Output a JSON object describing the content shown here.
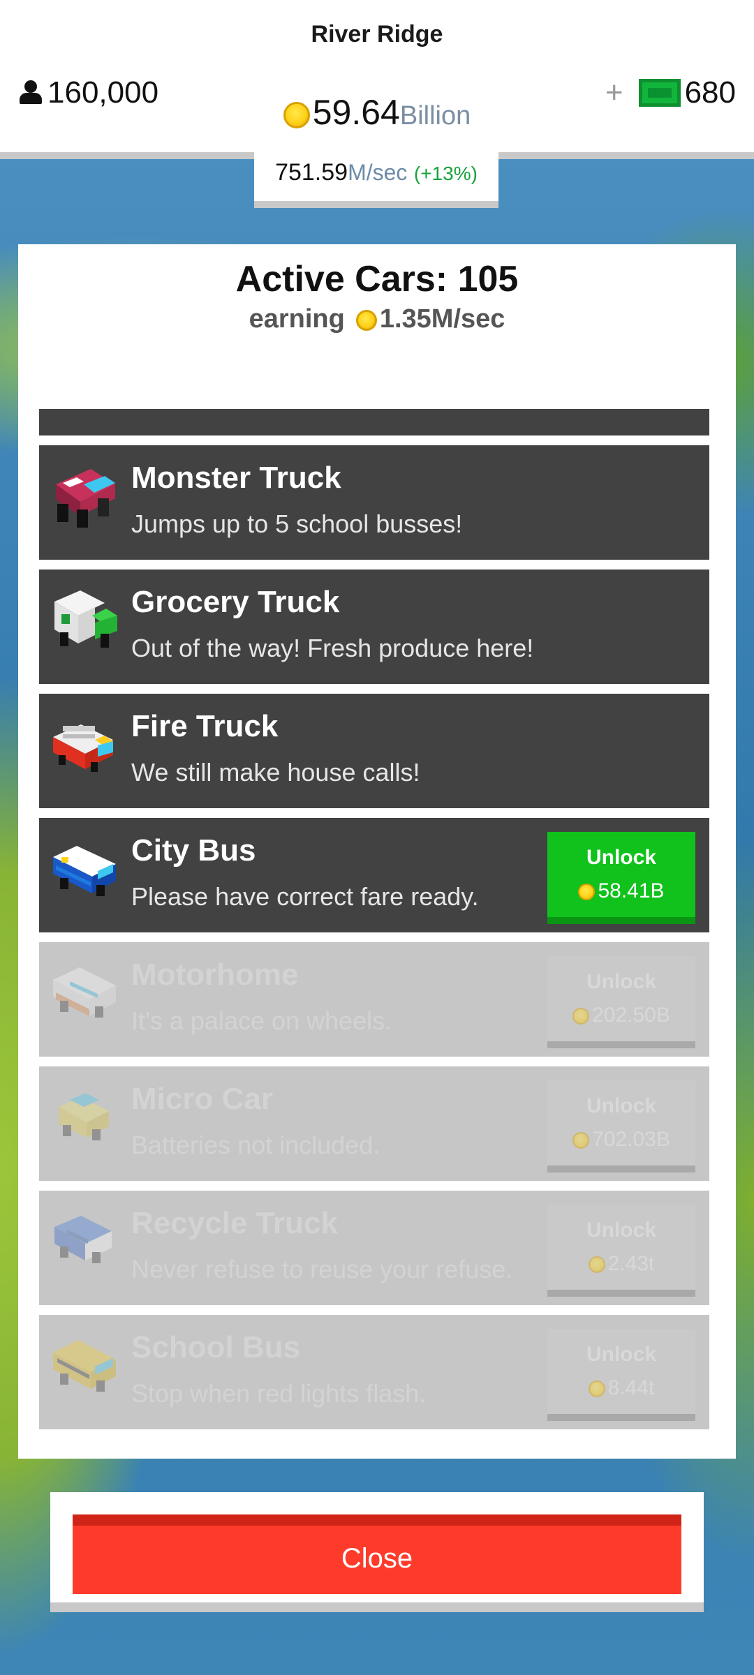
{
  "header": {
    "region_name": "River Ridge",
    "population": "160,000",
    "money_amount": "59.64",
    "money_unit": "Billion",
    "gems": "680",
    "plus": "+",
    "rate_value": "751.59",
    "rate_unit": "M/sec",
    "rate_bonus": "(+13%)"
  },
  "panel": {
    "title": "Active Cars: 105",
    "earning_label": "earning",
    "earning_value": "1.35M/sec"
  },
  "vehicles": [
    {
      "name": "Monster Truck",
      "desc": "Jumps up to 5 school busses!",
      "icon": "monster-truck-icon",
      "state": "owned"
    },
    {
      "name": "Grocery Truck",
      "desc": "Out of the way! Fresh produce here!",
      "icon": "grocery-truck-icon",
      "state": "owned"
    },
    {
      "name": "Fire Truck",
      "desc": "We still make house calls!",
      "icon": "fire-truck-icon",
      "state": "owned"
    },
    {
      "name": "City Bus",
      "desc": "Please have correct fare ready.",
      "icon": "city-bus-icon",
      "state": "unlockable",
      "unlock_label": "Unlock",
      "price": "58.41B"
    },
    {
      "name": "Motorhome",
      "desc": "It's a palace on wheels.",
      "icon": "motorhome-icon",
      "state": "locked",
      "unlock_label": "Unlock",
      "price": "202.50B"
    },
    {
      "name": "Micro Car",
      "desc": "Batteries not included.",
      "icon": "micro-car-icon",
      "state": "locked",
      "unlock_label": "Unlock",
      "price": "702.03B"
    },
    {
      "name": "Recycle Truck",
      "desc": "Never refuse to reuse your refuse.",
      "icon": "recycle-truck-icon",
      "state": "locked",
      "unlock_label": "Unlock",
      "price": "2.43t"
    },
    {
      "name": "School Bus",
      "desc": "Stop when red lights flash.",
      "icon": "school-bus-icon",
      "state": "locked",
      "unlock_label": "Unlock",
      "price": "8.44t"
    }
  ],
  "close_label": "Close",
  "colors": {
    "unlock_green": "#10c21b",
    "close_red": "#fe3b2b",
    "row_dark": "#424242",
    "row_locked": "#c6c6c6"
  }
}
